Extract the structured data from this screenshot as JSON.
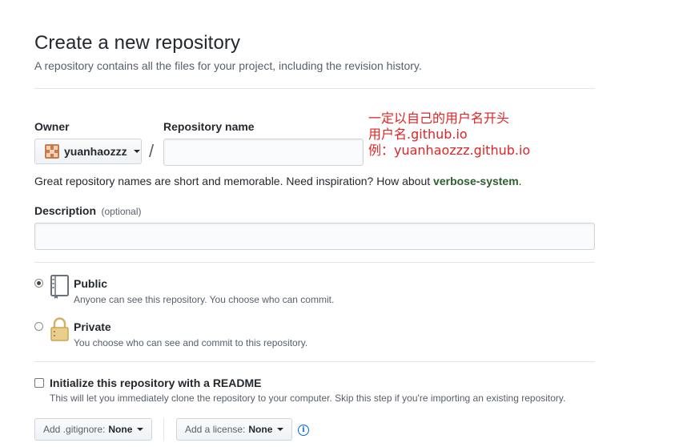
{
  "header": {
    "title": "Create a new repository",
    "subtitle": "A repository contains all the files for your project, including the revision history."
  },
  "owner": {
    "label": "Owner",
    "name": "yuanhaozzz"
  },
  "repo": {
    "label": "Repository name",
    "value": "",
    "separator": "/"
  },
  "annotation": {
    "line1": "一定以自己的用户名开头",
    "line2": "用户名.github.io",
    "line3": "例：yuanhaozzz.github.io"
  },
  "hint": {
    "prefix": "Great repository names are short and memorable. Need inspiration? How about ",
    "suggestion": "verbose-system",
    "suffix": "."
  },
  "description": {
    "label": "Description",
    "optional": "(optional)",
    "value": ""
  },
  "visibility": {
    "public": {
      "title": "Public",
      "note": "Anyone can see this repository. You choose who can commit.",
      "checked": true
    },
    "private": {
      "title": "Private",
      "note": "You choose who can see and commit to this repository.",
      "checked": false
    }
  },
  "readme": {
    "title": "Initialize this repository with a README",
    "note": "This will let you immediately clone the repository to your computer. Skip this step if you're importing an existing repository.",
    "checked": false
  },
  "gitignore": {
    "label": "Add .gitignore:",
    "value": "None"
  },
  "license": {
    "label": "Add a license:",
    "value": "None"
  },
  "icons": {
    "owner_avatar": "identicon-avatar",
    "public": "repo-book-icon",
    "private": "lock-icon",
    "info": "info-icon",
    "caret": "caret-down-icon"
  },
  "colors": {
    "annotation": "#e02424",
    "suggestion": "#2c5f2d",
    "info": "#0366d6"
  }
}
